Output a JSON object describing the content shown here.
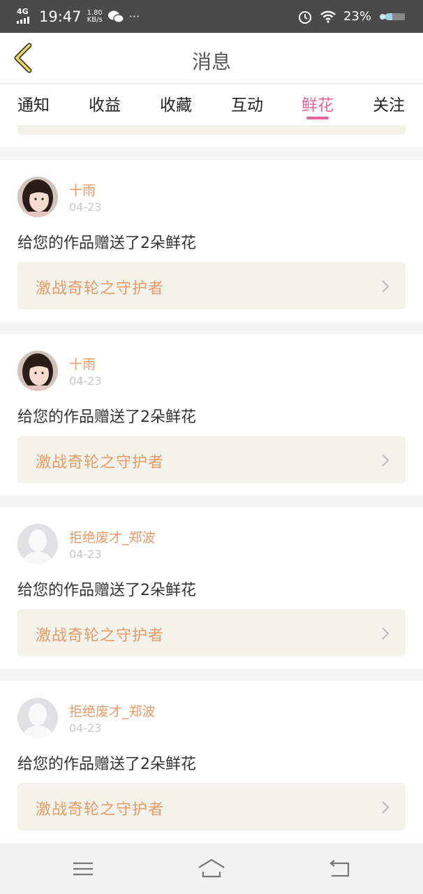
{
  "status": {
    "network": "4G",
    "time": "19:47",
    "speed_value": "1.80",
    "speed_unit": "KB/s",
    "more": "···",
    "battery": "23%",
    "icons": [
      "wechat-icon",
      "alarm-icon",
      "wifi-icon",
      "battery-icon"
    ]
  },
  "header": {
    "title": "消息"
  },
  "tabs": [
    {
      "label": "通知",
      "active": false
    },
    {
      "label": "收益",
      "active": false
    },
    {
      "label": "收藏",
      "active": false
    },
    {
      "label": "互动",
      "active": false
    },
    {
      "label": "鲜花",
      "active": true
    },
    {
      "label": "关注",
      "active": false
    }
  ],
  "messages": [
    {
      "username": "十雨",
      "date": "04-23",
      "text": "给您的作品赠送了2朵鲜花",
      "work_title": "激战奇轮之守护者",
      "avatar": "girl-photo"
    },
    {
      "username": "十雨",
      "date": "04-23",
      "text": "给您的作品赠送了2朵鲜花",
      "work_title": "激战奇轮之守护者",
      "avatar": "girl-photo"
    },
    {
      "username": "拒绝废才_郑波",
      "date": "04-23",
      "text": "给您的作品赠送了2朵鲜花",
      "work_title": "激战奇轮之守护者",
      "avatar": "default-silhouette"
    },
    {
      "username": "拒绝废才_郑波",
      "date": "04-23",
      "text": "给您的作品赠送了2朵鲜花",
      "work_title": "激战奇轮之守护者",
      "avatar": "default-silhouette"
    }
  ],
  "colors": {
    "accent": "#e5639c",
    "username": "#e89a68",
    "link_bg": "#f4f3eb"
  }
}
